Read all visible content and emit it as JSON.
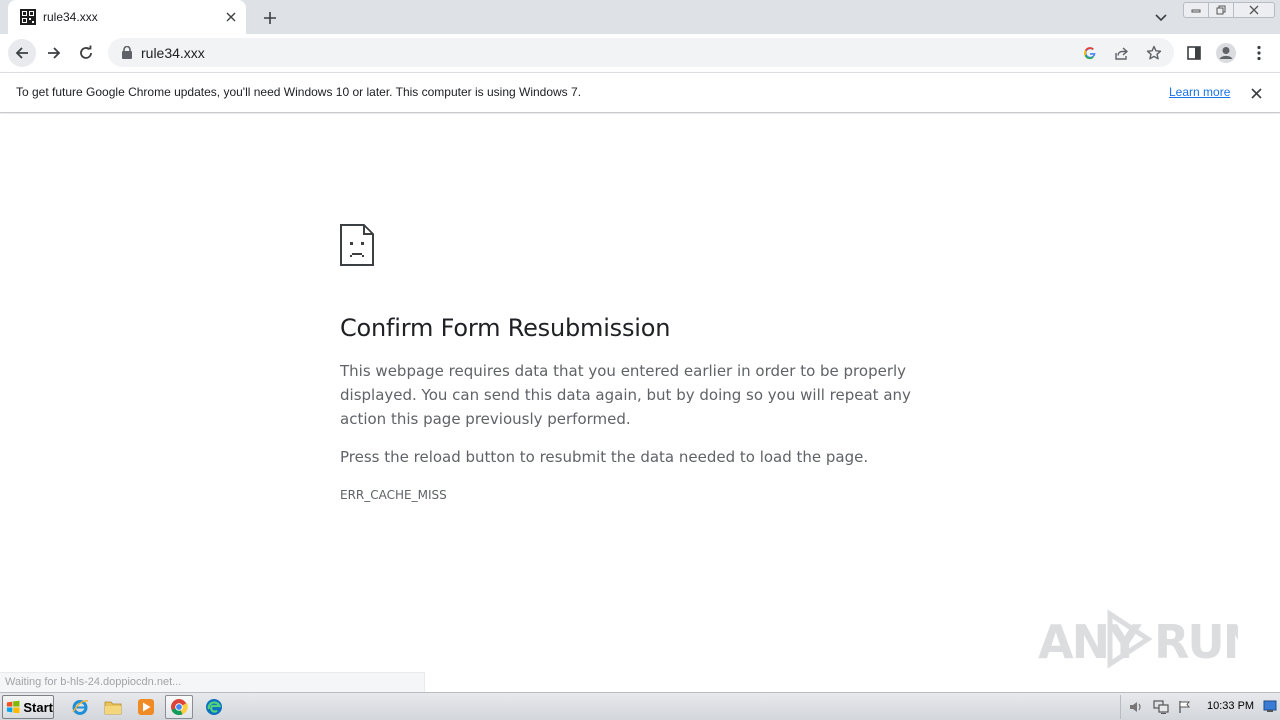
{
  "browser": {
    "tab": {
      "title": "rule34.xxx",
      "favicon": "site-favicon"
    },
    "url": "rule34.xxx"
  },
  "infobar": {
    "message": "To get future Google Chrome updates, you'll need Windows 10 or later. This computer is using Windows 7.",
    "link_label": "Learn more"
  },
  "error_page": {
    "icon": "sad-document-icon",
    "title": "Confirm Form Resubmission",
    "paragraph1": "This webpage requires data that you entered earlier in order to be properly displayed. You can send this data again, but by doing so you will repeat any action this page previously performed.",
    "paragraph2": "Press the reload button to resubmit the data needed to load the page.",
    "error_code": "ERR_CACHE_MISS"
  },
  "status_bar": {
    "text": "Waiting for b-hls-24.doppiocdn.net..."
  },
  "watermark": {
    "text": "ANY RUN"
  },
  "taskbar": {
    "start_label": "Start",
    "apps": [
      "internet-explorer-icon",
      "file-explorer-icon",
      "media-player-icon",
      "chrome-icon",
      "edge-icon"
    ],
    "clock": "10:33 PM"
  },
  "colors": {
    "accent": "#1a73e8",
    "tabstrip": "#dee1e6",
    "text_primary": "#202124",
    "text_secondary": "#5f6368"
  }
}
